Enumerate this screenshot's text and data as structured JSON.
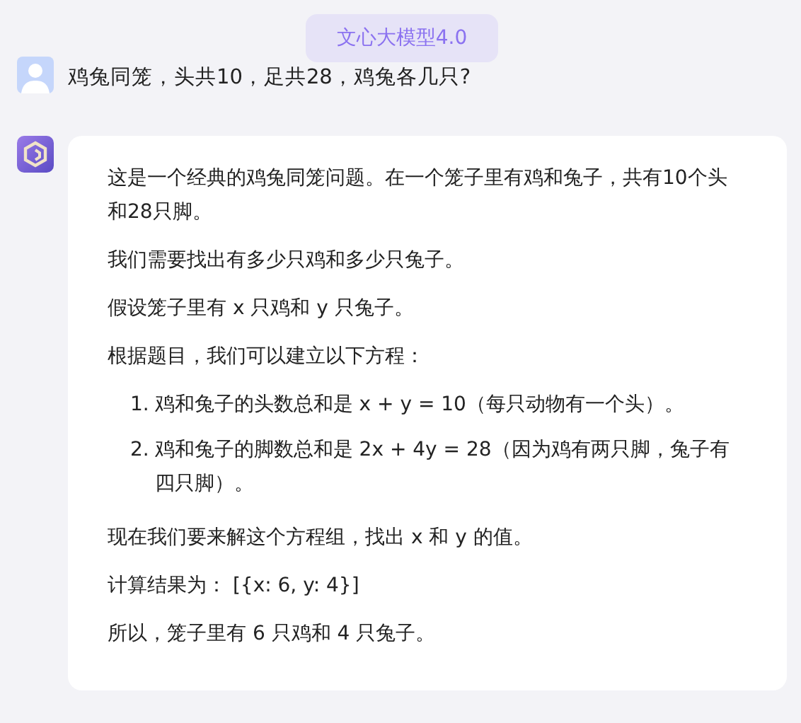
{
  "model_badge": "文心大模型4.0",
  "question": "鸡兔同笼，头共10，足共28，鸡兔各几只?",
  "answer": [
    {
      "kind": "paragraph",
      "text": "这是一个经典的鸡兔同笼问题。在一个笼子里有鸡和兔子，共有10个头和28只脚。"
    },
    {
      "kind": "paragraph",
      "text": "我们需要找出有多少只鸡和多少只兔子。"
    },
    {
      "kind": "paragraph",
      "text": "假设笼子里有 x 只鸡和 y 只兔子。"
    },
    {
      "kind": "paragraph",
      "text": "根据题目，我们可以建立以下方程："
    },
    {
      "kind": "list",
      "items": [
        {
          "number": "1.",
          "text": "鸡和兔子的头数总和是 x + y = 10（每只动物有一个头）。"
        },
        {
          "number": "2.",
          "text": "鸡和兔子的脚数总和是 2x + 4y = 28（因为鸡有两只脚，兔子有四只脚）。"
        }
      ]
    },
    {
      "kind": "paragraph",
      "text": "现在我们要来解这个方程组，找出 x 和 y 的值。"
    },
    {
      "kind": "paragraph",
      "text": "计算结果为：  [{x: 6, y: 4}]"
    },
    {
      "kind": "paragraph",
      "text": "所以，笼子里有 6 只鸡和 4 只兔子。"
    }
  ]
}
